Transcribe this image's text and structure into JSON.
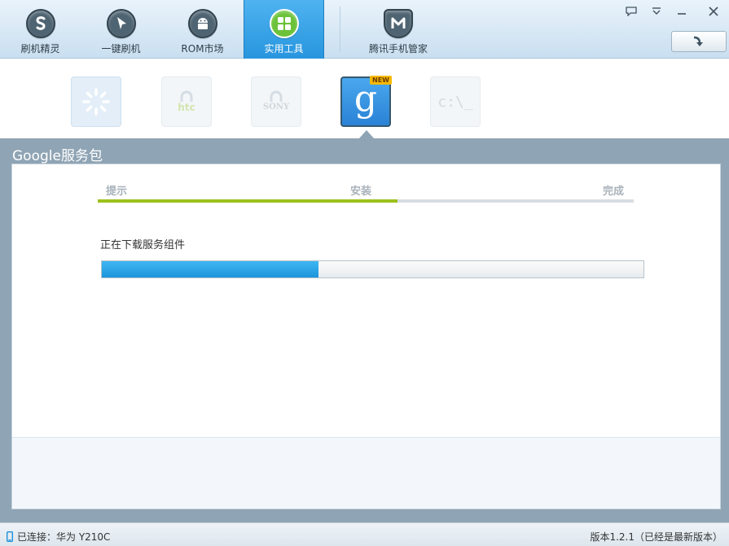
{
  "nav": {
    "items": [
      {
        "label": "刷机精灵",
        "icon": "shield-s-icon"
      },
      {
        "label": "一键刷机",
        "icon": "cursor-arrow-icon"
      },
      {
        "label": "ROM市场",
        "icon": "android-icon"
      },
      {
        "label": "实用工具",
        "icon": "grid-icon",
        "active": true
      },
      {
        "label": "腾讯手机管家",
        "icon": "tencent-manager-icon"
      }
    ]
  },
  "tools": [
    {
      "name": "loading",
      "state": "loading"
    },
    {
      "name": "htc-unlock",
      "text": "htc",
      "state": "disabled"
    },
    {
      "name": "sony-unlock",
      "text": "SONY",
      "state": "disabled"
    },
    {
      "name": "google-services",
      "text": "g",
      "badge": "NEW",
      "state": "selected"
    },
    {
      "name": "command-prompt",
      "text": "c:\\_",
      "state": "disabled"
    }
  ],
  "panel": {
    "title": "Google服务包",
    "steps": [
      {
        "label": "提示"
      },
      {
        "label": "安装"
      },
      {
        "label": "完成"
      }
    ],
    "step_progress": 0.56,
    "status_text": "正在下载服务组件",
    "download_progress": 0.4
  },
  "statusbar": {
    "connection": "已连接：华为 Y210C",
    "version": "版本1.2.1（已经是最新版本）"
  },
  "colors": {
    "accent_blue": "#2795de",
    "step_green": "#9cc11c",
    "progress_blue": "#1d95db",
    "panel_gray": "#8fa4b4"
  }
}
